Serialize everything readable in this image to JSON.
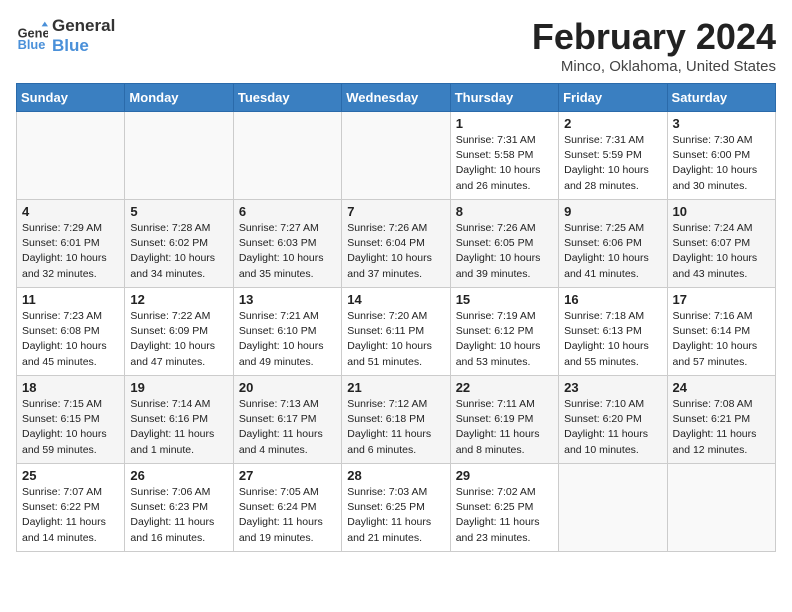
{
  "header": {
    "logo_line1": "General",
    "logo_line2": "Blue",
    "month": "February 2024",
    "location": "Minco, Oklahoma, United States"
  },
  "weekdays": [
    "Sunday",
    "Monday",
    "Tuesday",
    "Wednesday",
    "Thursday",
    "Friday",
    "Saturday"
  ],
  "weeks": [
    [
      {
        "day": "",
        "detail": ""
      },
      {
        "day": "",
        "detail": ""
      },
      {
        "day": "",
        "detail": ""
      },
      {
        "day": "",
        "detail": ""
      },
      {
        "day": "1",
        "detail": "Sunrise: 7:31 AM\nSunset: 5:58 PM\nDaylight: 10 hours\nand 26 minutes."
      },
      {
        "day": "2",
        "detail": "Sunrise: 7:31 AM\nSunset: 5:59 PM\nDaylight: 10 hours\nand 28 minutes."
      },
      {
        "day": "3",
        "detail": "Sunrise: 7:30 AM\nSunset: 6:00 PM\nDaylight: 10 hours\nand 30 minutes."
      }
    ],
    [
      {
        "day": "4",
        "detail": "Sunrise: 7:29 AM\nSunset: 6:01 PM\nDaylight: 10 hours\nand 32 minutes."
      },
      {
        "day": "5",
        "detail": "Sunrise: 7:28 AM\nSunset: 6:02 PM\nDaylight: 10 hours\nand 34 minutes."
      },
      {
        "day": "6",
        "detail": "Sunrise: 7:27 AM\nSunset: 6:03 PM\nDaylight: 10 hours\nand 35 minutes."
      },
      {
        "day": "7",
        "detail": "Sunrise: 7:26 AM\nSunset: 6:04 PM\nDaylight: 10 hours\nand 37 minutes."
      },
      {
        "day": "8",
        "detail": "Sunrise: 7:26 AM\nSunset: 6:05 PM\nDaylight: 10 hours\nand 39 minutes."
      },
      {
        "day": "9",
        "detail": "Sunrise: 7:25 AM\nSunset: 6:06 PM\nDaylight: 10 hours\nand 41 minutes."
      },
      {
        "day": "10",
        "detail": "Sunrise: 7:24 AM\nSunset: 6:07 PM\nDaylight: 10 hours\nand 43 minutes."
      }
    ],
    [
      {
        "day": "11",
        "detail": "Sunrise: 7:23 AM\nSunset: 6:08 PM\nDaylight: 10 hours\nand 45 minutes."
      },
      {
        "day": "12",
        "detail": "Sunrise: 7:22 AM\nSunset: 6:09 PM\nDaylight: 10 hours\nand 47 minutes."
      },
      {
        "day": "13",
        "detail": "Sunrise: 7:21 AM\nSunset: 6:10 PM\nDaylight: 10 hours\nand 49 minutes."
      },
      {
        "day": "14",
        "detail": "Sunrise: 7:20 AM\nSunset: 6:11 PM\nDaylight: 10 hours\nand 51 minutes."
      },
      {
        "day": "15",
        "detail": "Sunrise: 7:19 AM\nSunset: 6:12 PM\nDaylight: 10 hours\nand 53 minutes."
      },
      {
        "day": "16",
        "detail": "Sunrise: 7:18 AM\nSunset: 6:13 PM\nDaylight: 10 hours\nand 55 minutes."
      },
      {
        "day": "17",
        "detail": "Sunrise: 7:16 AM\nSunset: 6:14 PM\nDaylight: 10 hours\nand 57 minutes."
      }
    ],
    [
      {
        "day": "18",
        "detail": "Sunrise: 7:15 AM\nSunset: 6:15 PM\nDaylight: 10 hours\nand 59 minutes."
      },
      {
        "day": "19",
        "detail": "Sunrise: 7:14 AM\nSunset: 6:16 PM\nDaylight: 11 hours\nand 1 minute."
      },
      {
        "day": "20",
        "detail": "Sunrise: 7:13 AM\nSunset: 6:17 PM\nDaylight: 11 hours\nand 4 minutes."
      },
      {
        "day": "21",
        "detail": "Sunrise: 7:12 AM\nSunset: 6:18 PM\nDaylight: 11 hours\nand 6 minutes."
      },
      {
        "day": "22",
        "detail": "Sunrise: 7:11 AM\nSunset: 6:19 PM\nDaylight: 11 hours\nand 8 minutes."
      },
      {
        "day": "23",
        "detail": "Sunrise: 7:10 AM\nSunset: 6:20 PM\nDaylight: 11 hours\nand 10 minutes."
      },
      {
        "day": "24",
        "detail": "Sunrise: 7:08 AM\nSunset: 6:21 PM\nDaylight: 11 hours\nand 12 minutes."
      }
    ],
    [
      {
        "day": "25",
        "detail": "Sunrise: 7:07 AM\nSunset: 6:22 PM\nDaylight: 11 hours\nand 14 minutes."
      },
      {
        "day": "26",
        "detail": "Sunrise: 7:06 AM\nSunset: 6:23 PM\nDaylight: 11 hours\nand 16 minutes."
      },
      {
        "day": "27",
        "detail": "Sunrise: 7:05 AM\nSunset: 6:24 PM\nDaylight: 11 hours\nand 19 minutes."
      },
      {
        "day": "28",
        "detail": "Sunrise: 7:03 AM\nSunset: 6:25 PM\nDaylight: 11 hours\nand 21 minutes."
      },
      {
        "day": "29",
        "detail": "Sunrise: 7:02 AM\nSunset: 6:25 PM\nDaylight: 11 hours\nand 23 minutes."
      },
      {
        "day": "",
        "detail": ""
      },
      {
        "day": "",
        "detail": ""
      }
    ]
  ]
}
